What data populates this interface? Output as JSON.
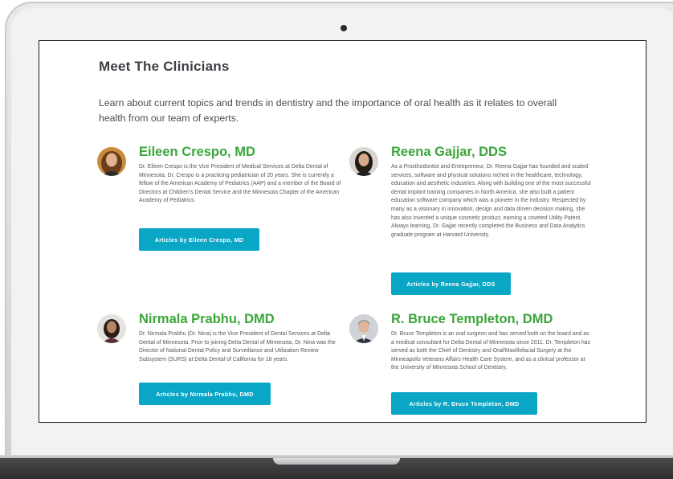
{
  "page": {
    "title": "Meet The Clinicians",
    "intro": "Learn about current topics and trends in dentistry and the importance of oral health as it relates to overall health from our team of experts."
  },
  "clinicians": [
    {
      "name": "Eileen Crespo, MD",
      "bio": "Dr. Eileen Crespo is the Vice President of Medical Services at Delta Dental of Minnesota. Dr. Crespo is a practicing pediatrician of 20 years. She is currently a fellow of the American Academy of Pediatrics (AAP) and a member of the Board of Directors at Children's Dental Service and the Minnesota Chapter of the American Academy of Pediatrics.",
      "button_label": "Articles by Eileen Crespo, MD"
    },
    {
      "name": "Reena Gajjar, DDS",
      "bio": "As a Prosthodontist and Entrepreneur, Dr. Reena Gajjar has founded and scaled services, software and physical solutions niched in the healthcare, technology, education and aesthetic industries. Along with building one of the most successful dental implant training companies in North America, she also built a patient education software company which was a pioneer in the industry. Respected by many as a visionary in innovation, design and data driven decision making, she has also invented a unique cosmetic product, earning a coveted Utility Patent. Always learning, Dr. Gajjar recently completed the Business and Data Analytics graduate program at Harvard University.",
      "button_label": "Articles by Reena Gajjar, DDS"
    },
    {
      "name": "Nirmala Prabhu, DMD",
      "bio": "Dr. Nirmala Prabhu (Dr. Nina) is the Vice President of Dental Services at Delta Dental of Minnesota. Prior to joining Delta Dental of Minnesota, Dr. Nina was the Director of National Dental Policy and Surveillance and Utilization Review Subsystem (SURS) at Delta Dental of California for 18 years.",
      "button_label": "Articles by Nirmala Prabhu, DMD"
    },
    {
      "name": "R. Bruce Templeton, DMD",
      "bio": "Dr. Bruce Templeton is an oral surgeon and has served both on the board and as a medical consultant for Delta Dental of Minnesota since 2011. Dr. Templeton has served as both the Chief of Dentistry and Oral/Maxillofacial Surgery at the Minneapolis Veterans Affairs Health Care System, and as a clinical professor at the University of Minnesota School of Dentistry.",
      "button_label": "Articles by R. Bruce Templeton, DMD"
    }
  ],
  "colors": {
    "name_green": "#3aa63a",
    "button_teal": "#0aa6c6",
    "heading": "#3c3f44"
  }
}
